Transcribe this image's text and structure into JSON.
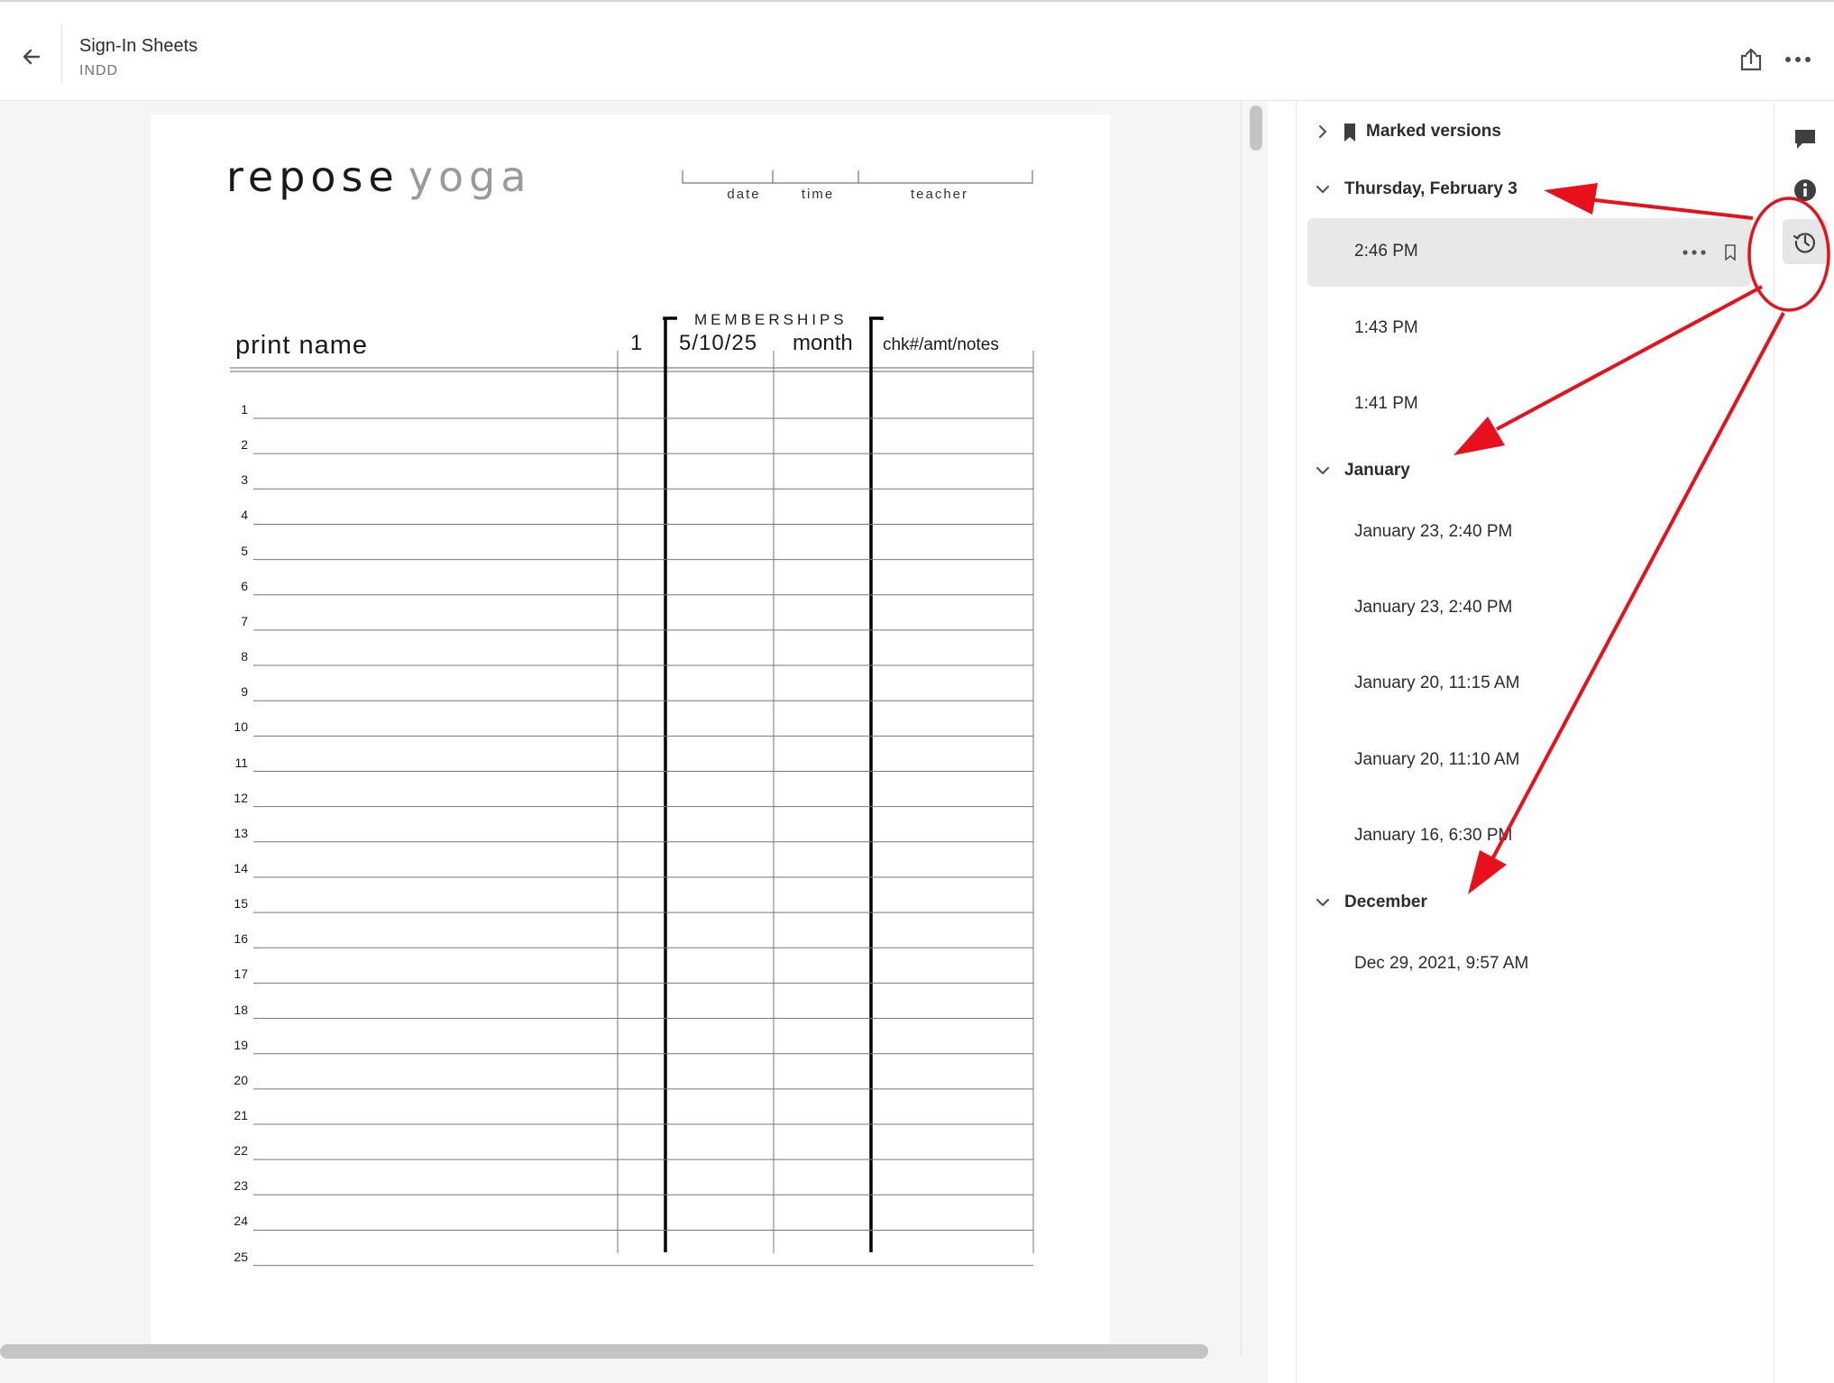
{
  "header": {
    "title": "Sign-In Sheets",
    "file_type": "INDD",
    "back_icon": "arrow-left-icon",
    "share_icon": "share-icon",
    "more_icon": "more-horizontal-icon"
  },
  "document": {
    "logo_part1": "repose",
    "logo_part2": "yoga",
    "header_fields": [
      "date",
      "time",
      "teacher"
    ],
    "memberships_label": "MEMBERSHIPS",
    "columns": {
      "print_name": "print name",
      "one": "1",
      "date": "5/10/25",
      "month": "month",
      "notes": "chk#/amt/notes"
    },
    "row_numbers": [
      "1",
      "2",
      "3",
      "4",
      "5",
      "6",
      "7",
      "8",
      "9",
      "10",
      "11",
      "12",
      "13",
      "14",
      "15",
      "16",
      "17",
      "18",
      "19",
      "20",
      "21",
      "22",
      "23",
      "24",
      "25"
    ]
  },
  "versions_panel": {
    "marked_versions": "Marked versions",
    "groups": [
      {
        "label": "Thursday, February 3",
        "versions": [
          "2:46 PM",
          "1:43 PM",
          "1:41 PM"
        ],
        "selected": "2:46 PM"
      },
      {
        "label": "January",
        "versions": [
          "January 23, 2:40 PM",
          "January 23, 2:40 PM",
          "January 20, 11:15 AM",
          "January 20, 11:10 AM",
          "January 16, 6:30 PM"
        ]
      },
      {
        "label": "December",
        "versions": [
          "Dec 29, 2021, 9:57 AM"
        ]
      }
    ]
  },
  "rail": {
    "icons": [
      "comment-icon",
      "info-icon",
      "version-history-icon"
    ],
    "active": "version-history-icon"
  },
  "colors": {
    "annotation": "#e8101a",
    "selected_bg": "#e8e8e8",
    "canvas_bg": "#f5f5f5"
  }
}
